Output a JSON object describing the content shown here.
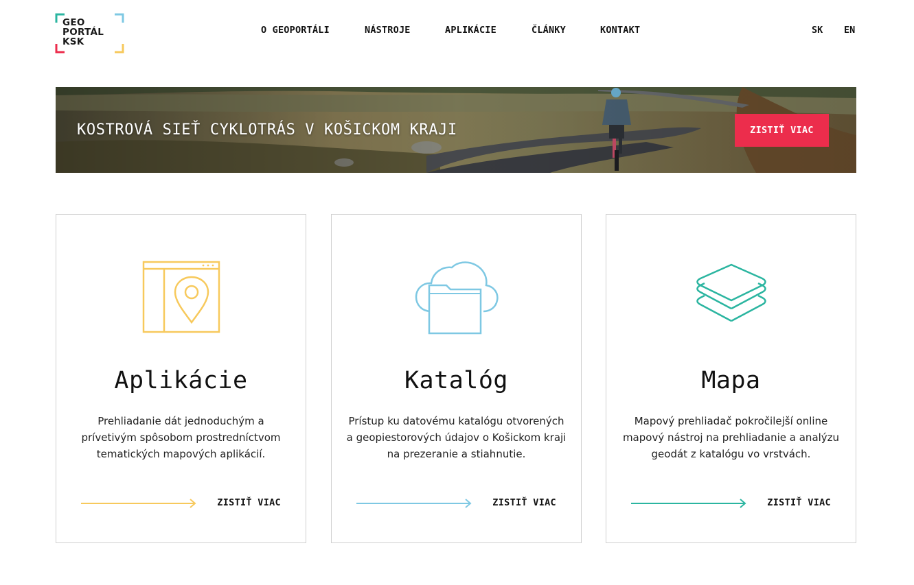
{
  "logo": {
    "line1": "GEO",
    "line2": "PORTÁL",
    "line3": "KSK"
  },
  "nav": {
    "items": [
      {
        "label": "O GEOPORTÁLI"
      },
      {
        "label": "NÁSTROJE"
      },
      {
        "label": "APLIKÁCIE"
      },
      {
        "label": "ČLÁNKY"
      },
      {
        "label": "KONTAKT"
      }
    ]
  },
  "languages": {
    "sk": "SK",
    "en": "EN"
  },
  "banner": {
    "title": "KOSTROVÁ SIEŤ CYKLOTRÁS V KOŠICKOM KRAJI",
    "button_label": "ZISTIŤ VIAC"
  },
  "cards": [
    {
      "icon": "map-pin-window-icon",
      "color": "#f7c95c",
      "title": "Aplikácie",
      "description": "Prehliadanie dát jednoduchým a prívetivým spôsobom prostredníctvom tematických mapových aplikácií.",
      "link_label": "ZISTIŤ VIAC"
    },
    {
      "icon": "cloud-folder-icon",
      "color": "#7ec8e3",
      "title": "Katalóg",
      "description": "Prístup ku datovému katalógu otvorených a geopiestorových údajov o Košickom kraji na prezeranie a stiahnutie.",
      "link_label": "ZISTIŤ VIAC"
    },
    {
      "icon": "layers-icon",
      "color": "#2bb5a0",
      "title": "Mapa",
      "description": "Mapový prehliadač pokročilejší online mapový nástroj na prehliadanie a analýzu geodát z katalógu vo vrstvách.",
      "link_label": "ZISTIŤ VIAC"
    }
  ]
}
